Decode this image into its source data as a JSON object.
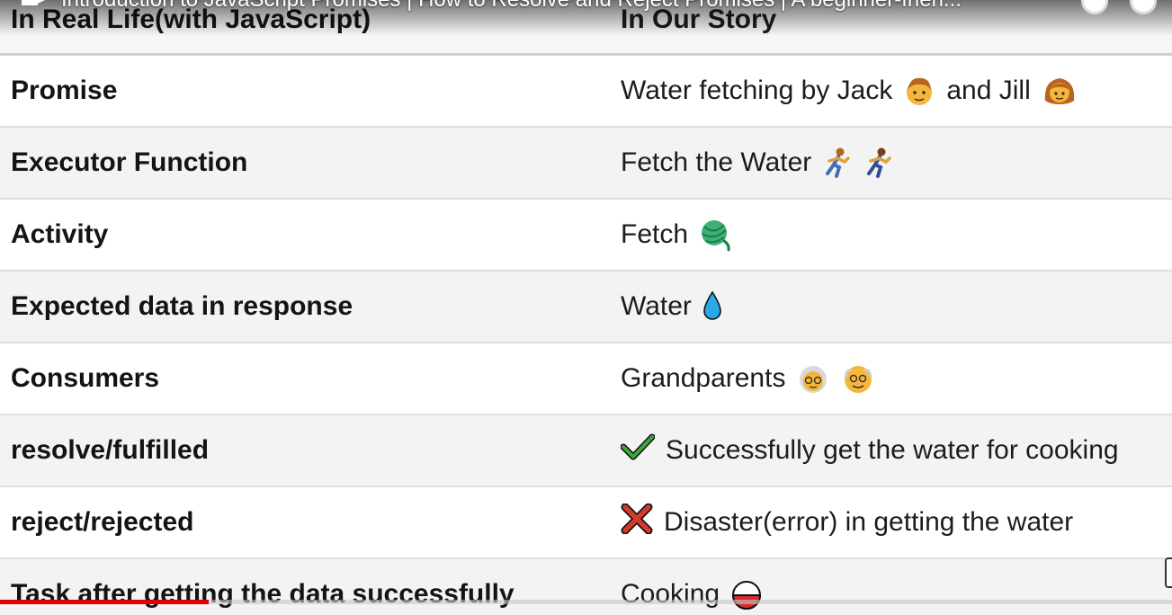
{
  "video": {
    "title": "Introduction to JavaScript Promises | How to Resolve and Reject Promises | A beginner-frien...",
    "progress_fraction": 0.178
  },
  "table": {
    "header": {
      "left": "In Real Life(with JavaScript)",
      "right": "In Our Story"
    },
    "rows": [
      {
        "left": "Promise",
        "right": "Water fetching by Jack",
        "right_mid": "and Jill",
        "icons": [
          "boy-emoji-icon",
          "girl-emoji-icon"
        ]
      },
      {
        "left": "Executor Function",
        "right": "Fetch the Water",
        "icons": [
          "person-running-icon",
          "person-running-icon"
        ]
      },
      {
        "left": "Activity",
        "right": "Fetch",
        "icons": [
          "yarn-ball-icon"
        ]
      },
      {
        "left": "Expected data in response",
        "right": "Water",
        "icons": [
          "droplet-icon"
        ]
      },
      {
        "left": "Consumers",
        "right": "Grandparents",
        "icons": [
          "grandma-emoji-icon",
          "grandpa-emoji-icon"
        ]
      },
      {
        "left": "resolve/fulfilled",
        "right": "Successfully get the water for cooking",
        "icons": [
          "check-mark-icon"
        ]
      },
      {
        "left": "reject/rejected",
        "right": "Disaster(error) in getting the water",
        "icons": [
          "cross-mark-icon"
        ]
      },
      {
        "left": "Task after getting the data successfully",
        "right": "Cooking",
        "icons": [
          "pot-icon"
        ]
      }
    ]
  },
  "colors": {
    "progress": "#e00000",
    "check": "#3aa83a",
    "cross": "#d33a2c",
    "droplet": "#1e88e5",
    "yarn": "#3bb273",
    "emoji_skin": "#f5b63c"
  }
}
